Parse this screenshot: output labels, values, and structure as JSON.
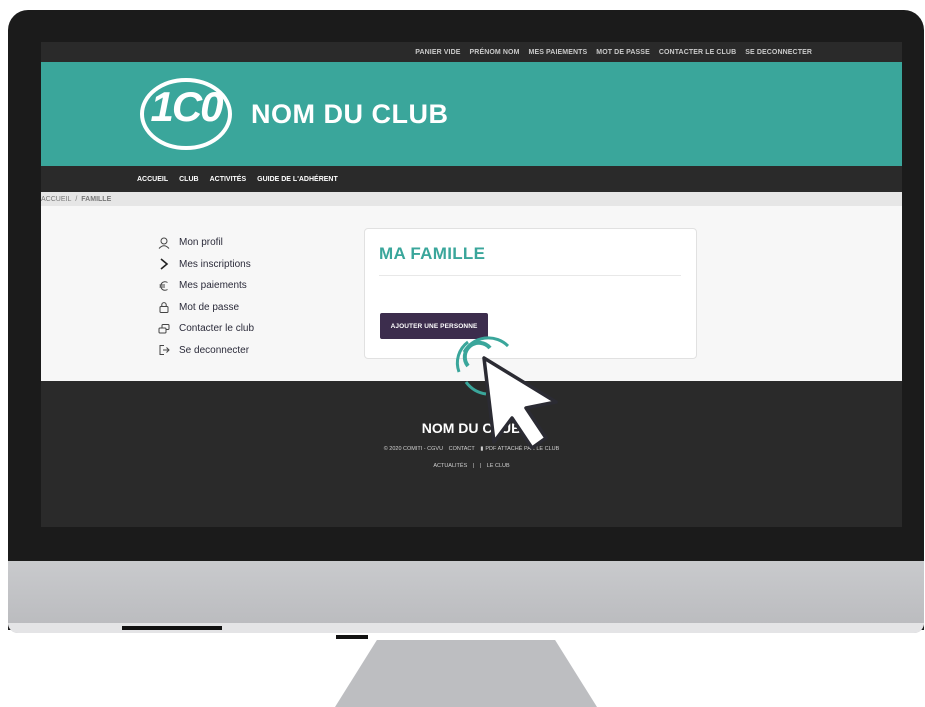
{
  "topbar": {
    "links": [
      "PANIER VIDE",
      "PRÉNOM NOM",
      "MES PAIEMENTS",
      "MOT DE PASSE",
      "CONTACTER LE CLUB",
      "SE DECONNECTER"
    ]
  },
  "header": {
    "logo_text": "1C0",
    "club_name": "NOM DU CLUB"
  },
  "mainnav": {
    "items": [
      "ACCUEIL",
      "CLUB",
      "ACTIVITÉS",
      "GUIDE DE L'ADHÉRENT"
    ]
  },
  "breadcrumb": {
    "home": "ACCUEIL",
    "separator": "/",
    "current": "FAMILLE"
  },
  "sidemenu": {
    "items": [
      {
        "label": "Mon profil",
        "icon": "user-icon"
      },
      {
        "label": "Mes inscriptions",
        "icon": "chevron-right-icon"
      },
      {
        "label": "Mes paiements",
        "icon": "euro-icon"
      },
      {
        "label": "Mot de passe",
        "icon": "lock-icon"
      },
      {
        "label": "Contacter le club",
        "icon": "chat-icon"
      },
      {
        "label": "Se deconnecter",
        "icon": "logout-icon"
      }
    ]
  },
  "card": {
    "title": "MA FAMILLE",
    "add_button": "AJOUTER UNE PERSONNE"
  },
  "footer": {
    "title": "NOM DU CLUB",
    "copyright": "© 2020 COMITI - CGVU",
    "contact": "CONTACT",
    "pdf": "PDF ATTACHÉ PAR LE CLUB",
    "news": "ACTUALITÉS",
    "divider": "|",
    "club": "LE CLUB"
  },
  "colors": {
    "brand_teal": "#3aa69b",
    "dark_bar": "#2a2a2a",
    "button_purple": "#3c2d4d"
  }
}
